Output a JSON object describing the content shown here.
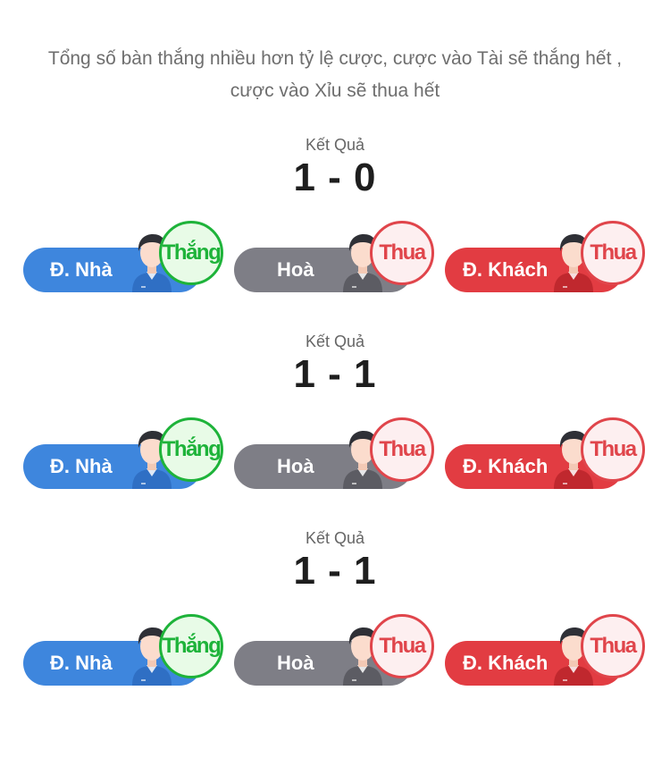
{
  "description": "Tổng số bàn thắng nhiều hơn tỷ lệ cược, cược vào Tài sẽ thắng hết , cược vào Xỉu sẽ thua hết",
  "colors": {
    "home": "#3e86dd",
    "draw": "#7e7e86",
    "away": "#e23c42",
    "win": "#1eb33a",
    "lose": "#e0454b"
  },
  "sections": [
    {
      "label": "Kết Quả",
      "score": "1 - 0",
      "home": {
        "label": "Đ. Nhà",
        "badge": "Thắng"
      },
      "draw": {
        "label": "Hoà",
        "badge": "Thua"
      },
      "away": {
        "label": "Đ. Khách",
        "badge": "Thua"
      }
    },
    {
      "label": "Kết Quả",
      "score": "1 - 1",
      "home": {
        "label": "Đ. Nhà",
        "badge": "Thắng"
      },
      "draw": {
        "label": "Hoà",
        "badge": "Thua"
      },
      "away": {
        "label": "Đ. Khách",
        "badge": "Thua"
      }
    },
    {
      "label": "Kết Quả",
      "score": "1 - 1",
      "home": {
        "label": "Đ. Nhà",
        "badge": "Thắng"
      },
      "draw": {
        "label": "Hoà",
        "badge": "Thua"
      },
      "away": {
        "label": "Đ. Khách",
        "badge": "Thua"
      }
    }
  ]
}
